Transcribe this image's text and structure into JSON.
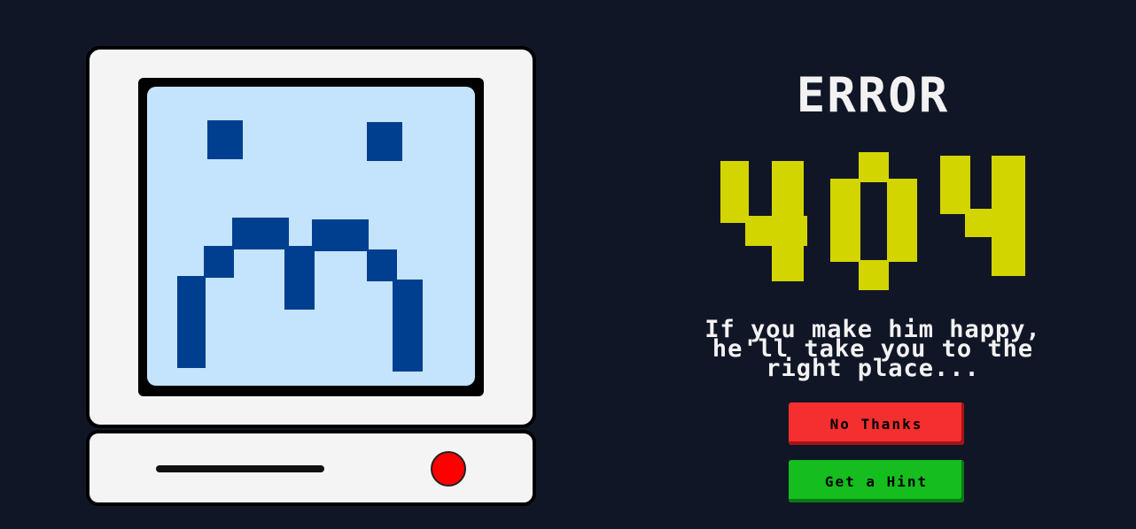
{
  "heading": "ERROR",
  "code": "404",
  "message": {
    "line1": "If you make him happy,",
    "line2": "he'll take you to the",
    "line3": "right place..."
  },
  "buttons": {
    "no_thanks": "No Thanks",
    "hint": "Get a Hint"
  },
  "colors": {
    "background": "#111627",
    "screen": "#c4e3fd",
    "face": "#003f8f",
    "code": "#d3d500",
    "no_thanks": "#f52f2f",
    "hint": "#15bd1f",
    "power_led": "#ff0000"
  },
  "icons": {
    "face": "sad-face-icon",
    "power": "power-led-icon"
  }
}
